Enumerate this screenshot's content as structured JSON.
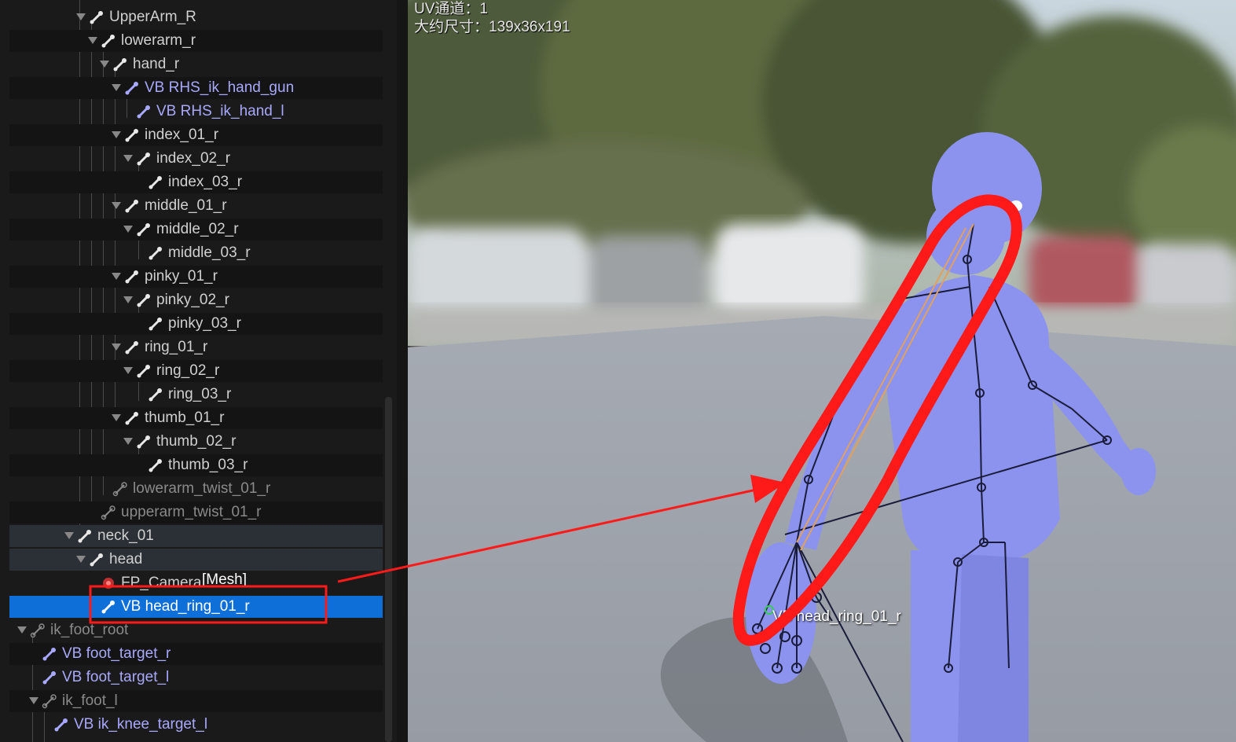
{
  "skeleton_tree": {
    "rows": [
      {
        "label": "UpperArm_R",
        "style": "normal",
        "icon": "bone-icon"
      },
      {
        "label": "lowerarm_r",
        "style": "normal",
        "icon": "bone-icon"
      },
      {
        "label": "hand_r",
        "style": "normal",
        "icon": "bone-icon"
      },
      {
        "label": "VB RHS_ik_hand_gun",
        "style": "virtual",
        "icon": "virtual-bone-icon"
      },
      {
        "label": "VB RHS_ik_hand_l",
        "style": "virtual",
        "icon": "virtual-bone-icon"
      },
      {
        "label": "index_01_r",
        "style": "normal",
        "icon": "bone-icon"
      },
      {
        "label": "index_02_r",
        "style": "normal",
        "icon": "bone-icon"
      },
      {
        "label": "index_03_r",
        "style": "normal",
        "icon": "bone-icon"
      },
      {
        "label": "middle_01_r",
        "style": "normal",
        "icon": "bone-icon"
      },
      {
        "label": "middle_02_r",
        "style": "normal",
        "icon": "bone-icon"
      },
      {
        "label": "middle_03_r",
        "style": "normal",
        "icon": "bone-icon"
      },
      {
        "label": "pinky_01_r",
        "style": "normal",
        "icon": "bone-icon"
      },
      {
        "label": "pinky_02_r",
        "style": "normal",
        "icon": "bone-icon"
      },
      {
        "label": "pinky_03_r",
        "style": "normal",
        "icon": "bone-icon"
      },
      {
        "label": "ring_01_r",
        "style": "normal",
        "icon": "bone-icon"
      },
      {
        "label": "ring_02_r",
        "style": "normal",
        "icon": "bone-icon"
      },
      {
        "label": "ring_03_r",
        "style": "normal",
        "icon": "bone-icon"
      },
      {
        "label": "thumb_01_r",
        "style": "normal",
        "icon": "bone-icon"
      },
      {
        "label": "thumb_02_r",
        "style": "normal",
        "icon": "bone-icon"
      },
      {
        "label": "thumb_03_r",
        "style": "normal",
        "icon": "bone-icon"
      },
      {
        "label": "lowerarm_twist_01_r",
        "style": "dim",
        "icon": "unweighted-bone-icon"
      },
      {
        "label": "upperarm_twist_01_r",
        "style": "dim",
        "icon": "unweighted-bone-icon"
      },
      {
        "label": "neck_01",
        "style": "highlight",
        "icon": "bone-icon"
      },
      {
        "label": "head",
        "style": "highlight",
        "icon": "bone-icon"
      },
      {
        "label": "FP_Camera",
        "style": "normal",
        "icon": "socket-icon",
        "suffix": "[Mesh]"
      },
      {
        "label": "VB head_ring_01_r",
        "style": "selected",
        "icon": "virtual-bone-icon"
      },
      {
        "label": "ik_foot_root",
        "style": "dim",
        "icon": "unweighted-bone-icon"
      },
      {
        "label": "VB foot_target_r",
        "style": "virtual",
        "icon": "virtual-bone-icon"
      },
      {
        "label": "VB foot_target_l",
        "style": "virtual",
        "icon": "virtual-bone-icon"
      },
      {
        "label": "ik_foot_l",
        "style": "dim",
        "icon": "unweighted-bone-icon"
      },
      {
        "label": "VB ik_knee_target_l",
        "style": "virtual",
        "icon": "virtual-bone-icon"
      }
    ]
  },
  "viewport": {
    "uv_channel": "UV通道：1",
    "approx_size": "大约尺寸：139x36x191",
    "bone_label": "VB head_ring_01_r"
  },
  "colors": {
    "selection": "#0f6fd8",
    "virtual_bone_text": "#a8a8ff",
    "mannequin": "#8c93ee",
    "annotation_red": "#ff1a1a"
  }
}
